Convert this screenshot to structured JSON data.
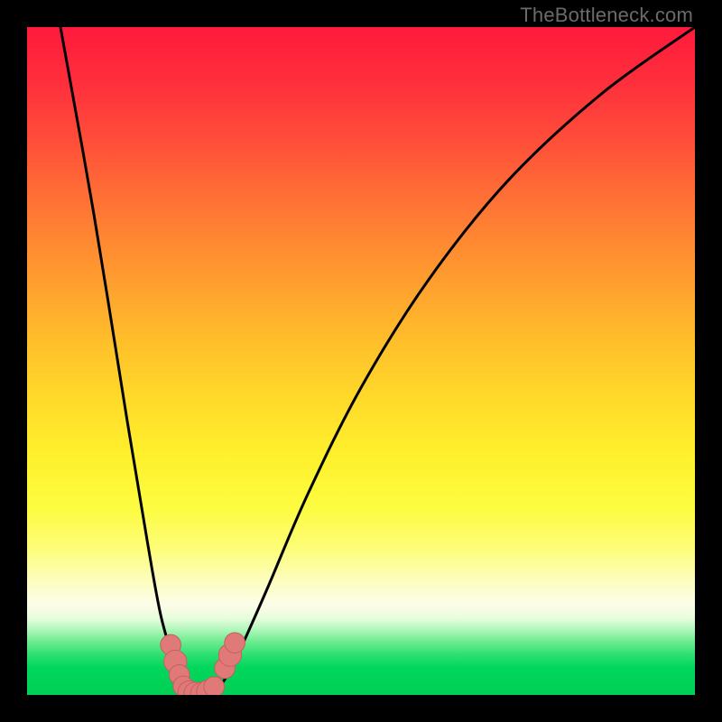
{
  "watermark": "TheBottleneck.com",
  "colors": {
    "frame": "#000000",
    "curve": "#000000",
    "marker_fill": "#e07a78",
    "marker_stroke": "#c55f5d"
  },
  "chart_data": {
    "type": "line",
    "title": "",
    "xlabel": "",
    "ylabel": "",
    "xlim": [
      0,
      100
    ],
    "ylim": [
      0,
      100
    ],
    "grid": false,
    "note": "Percent-bottleneck style V-curve; minimum ≈0 at x≈24–28. Values estimated from pixel positions (no axis ticks shown).",
    "series": [
      {
        "name": "bottleneck-curve",
        "x": [
          5,
          10,
          15,
          18,
          20,
          22,
          23,
          24,
          25,
          26,
          27,
          28,
          29,
          30,
          32,
          36,
          42,
          50,
          60,
          72,
          86,
          100
        ],
        "y": [
          100,
          72,
          41,
          23,
          12,
          5,
          2,
          0.5,
          0,
          0,
          0,
          0.5,
          1.5,
          3,
          7,
          16,
          30,
          46,
          62,
          77,
          90,
          100
        ]
      }
    ],
    "markers": [
      {
        "x": 21.5,
        "y": 7.5,
        "r": 1.1
      },
      {
        "x": 22.2,
        "y": 5.0,
        "r": 1.3
      },
      {
        "x": 22.8,
        "y": 3.0,
        "r": 1.1
      },
      {
        "x": 23.4,
        "y": 1.3,
        "r": 1.1
      },
      {
        "x": 24.3,
        "y": 0.4,
        "r": 1.3
      },
      {
        "x": 25.2,
        "y": 0.2,
        "r": 1.3
      },
      {
        "x": 26.2,
        "y": 0.2,
        "r": 1.3
      },
      {
        "x": 27.1,
        "y": 0.5,
        "r": 1.3
      },
      {
        "x": 28.0,
        "y": 1.2,
        "r": 1.1
      },
      {
        "x": 29.6,
        "y": 4.0,
        "r": 1.1
      },
      {
        "x": 30.4,
        "y": 6.0,
        "r": 1.3
      },
      {
        "x": 31.1,
        "y": 7.8,
        "r": 1.1
      }
    ]
  }
}
